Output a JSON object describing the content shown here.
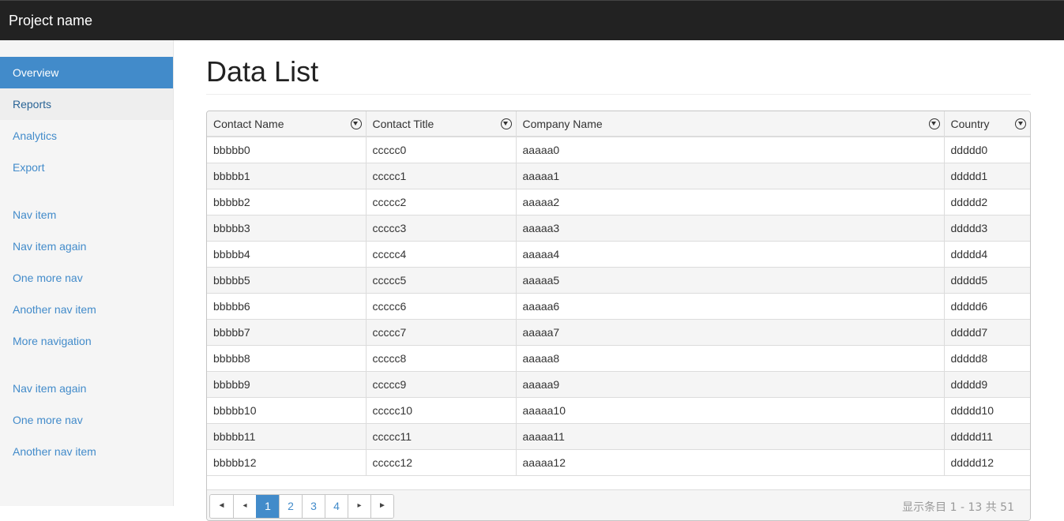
{
  "app": {
    "brand": "Project name"
  },
  "sidebar": {
    "groups": [
      [
        "Overview",
        "Reports",
        "Analytics",
        "Export"
      ],
      [
        "Nav item",
        "Nav item again",
        "One more nav",
        "Another nav item",
        "More navigation"
      ],
      [
        "Nav item again",
        "One more nav",
        "Another nav item"
      ]
    ],
    "active": "Overview",
    "hover": "Reports"
  },
  "main": {
    "title": "Data List"
  },
  "grid": {
    "columns": [
      "Contact Name",
      "Contact Title",
      "Company Name",
      "Country"
    ],
    "rows": [
      [
        "bbbbb0",
        "ccccc0",
        "aaaaa0",
        "ddddd0"
      ],
      [
        "bbbbb1",
        "ccccc1",
        "aaaaa1",
        "ddddd1"
      ],
      [
        "bbbbb2",
        "ccccc2",
        "aaaaa2",
        "ddddd2"
      ],
      [
        "bbbbb3",
        "ccccc3",
        "aaaaa3",
        "ddddd3"
      ],
      [
        "bbbbb4",
        "ccccc4",
        "aaaaa4",
        "ddddd4"
      ],
      [
        "bbbbb5",
        "ccccc5",
        "aaaaa5",
        "ddddd5"
      ],
      [
        "bbbbb6",
        "ccccc6",
        "aaaaa6",
        "ddddd6"
      ],
      [
        "bbbbb7",
        "ccccc7",
        "aaaaa7",
        "ddddd7"
      ],
      [
        "bbbbb8",
        "ccccc8",
        "aaaaa8",
        "ddddd8"
      ],
      [
        "bbbbb9",
        "ccccc9",
        "aaaaa9",
        "ddddd9"
      ],
      [
        "bbbbb10",
        "ccccc10",
        "aaaaa10",
        "ddddd10"
      ],
      [
        "bbbbb11",
        "ccccc11",
        "aaaaa11",
        "ddddd11"
      ],
      [
        "bbbbb12",
        "ccccc12",
        "aaaaa12",
        "ddddd12"
      ]
    ]
  },
  "pager": {
    "first_icon": "first-page-icon",
    "first_glyph": "◄",
    "prev_icon": "prev-page-icon",
    "prev_glyph": "◂",
    "pages": [
      "1",
      "2",
      "3",
      "4"
    ],
    "current": "1",
    "next_icon": "next-page-icon",
    "next_glyph": "▸",
    "last_icon": "last-page-icon",
    "last_glyph": "►",
    "info": "显示条目 1 - 13 共 51"
  },
  "colors": {
    "accent": "#428bca",
    "topbar": "#222222"
  }
}
